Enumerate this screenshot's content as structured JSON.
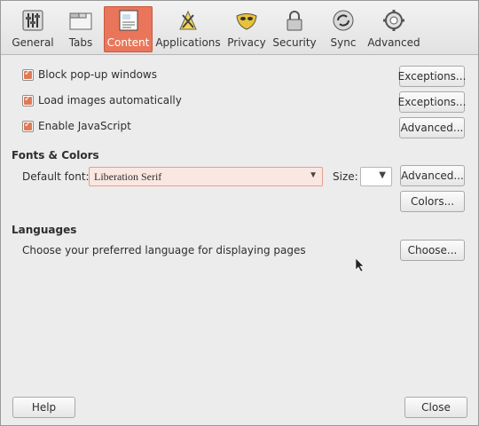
{
  "toolbar": {
    "tabs": [
      {
        "label": "General"
      },
      {
        "label": "Tabs"
      },
      {
        "label": "Content"
      },
      {
        "label": "Applications"
      },
      {
        "label": "Privacy"
      },
      {
        "label": "Security"
      },
      {
        "label": "Sync"
      },
      {
        "label": "Advanced"
      }
    ],
    "active_tab": "Content",
    "accent_color": "#e9765a"
  },
  "content": {
    "block_popups": {
      "label": "Block pop-up windows",
      "checked": true,
      "button": "Exceptions..."
    },
    "load_images": {
      "label": "Load images automatically",
      "checked": true,
      "button": "Exceptions..."
    },
    "javascript": {
      "label": "Enable JavaScript",
      "checked": true,
      "button": "Advanced..."
    }
  },
  "fonts": {
    "heading": "Fonts & Colors",
    "default_font_label": "Default font:",
    "default_font_value": "Liberation Serif",
    "size_label": "Size:",
    "size_value": "",
    "advanced_button": "Advanced...",
    "colors_button": "Colors..."
  },
  "languages": {
    "heading": "Languages",
    "description": "Choose your preferred language for displaying pages",
    "choose_button": "Choose..."
  },
  "footer": {
    "help_button": "Help",
    "close_button": "Close"
  }
}
